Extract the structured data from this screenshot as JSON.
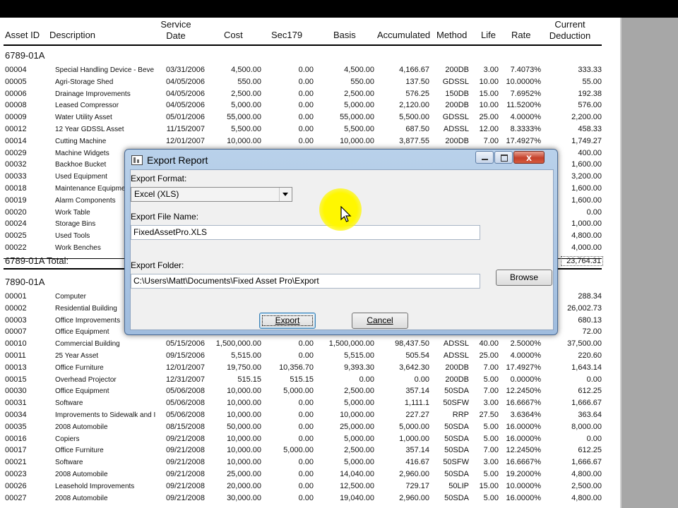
{
  "headers": {
    "asset_id": "Asset ID",
    "description": "Description",
    "service_date_1": "Service",
    "service_date_2": "Date",
    "cost": "Cost",
    "sec179": "Sec179",
    "basis": "Basis",
    "accumulated": "Accumulated",
    "method": "Method",
    "life": "Life",
    "rate": "Rate",
    "current_deduction_1": "Current",
    "current_deduction_2": "Deduction"
  },
  "groups": [
    {
      "title": "6789-01A",
      "rows": [
        {
          "id": "00004",
          "desc": "Special Handling Device - Beve",
          "date": "03/31/2006",
          "cost": "4,500.00",
          "sec": "0.00",
          "basis": "4,500.00",
          "acc": "4,166.67",
          "meth": "200DB",
          "life": "3.00",
          "rate": "7.4073%",
          "ded": "333.33"
        },
        {
          "id": "00005",
          "desc": "Agri-Storage Shed",
          "date": "04/05/2006",
          "cost": "550.00",
          "sec": "0.00",
          "basis": "550.00",
          "acc": "137.50",
          "meth": "GDSSL",
          "life": "10.00",
          "rate": "10.0000%",
          "ded": "55.00"
        },
        {
          "id": "00006",
          "desc": "Drainage Improvements",
          "date": "04/05/2006",
          "cost": "2,500.00",
          "sec": "0.00",
          "basis": "2,500.00",
          "acc": "576.25",
          "meth": "150DB",
          "life": "15.00",
          "rate": "7.6952%",
          "ded": "192.38"
        },
        {
          "id": "00008",
          "desc": "Leased Compressor",
          "date": "04/05/2006",
          "cost": "5,000.00",
          "sec": "0.00",
          "basis": "5,000.00",
          "acc": "2,120.00",
          "meth": "200DB",
          "life": "10.00",
          "rate": "11.5200%",
          "ded": "576.00"
        },
        {
          "id": "00009",
          "desc": "Water Utility Asset",
          "date": "05/01/2006",
          "cost": "55,000.00",
          "sec": "0.00",
          "basis": "55,000.00",
          "acc": "5,500.00",
          "meth": "GDSSL",
          "life": "25.00",
          "rate": "4.0000%",
          "ded": "2,200.00"
        },
        {
          "id": "00012",
          "desc": "12 Year GDSSL Asset",
          "date": "11/15/2007",
          "cost": "5,500.00",
          "sec": "0.00",
          "basis": "5,500.00",
          "acc": "687.50",
          "meth": "ADSSL",
          "life": "12.00",
          "rate": "8.3333%",
          "ded": "458.33"
        },
        {
          "id": "00014",
          "desc": "Cutting Machine",
          "date": "12/01/2007",
          "cost": "10,000.00",
          "sec": "0.00",
          "basis": "10,000.00",
          "acc": "3,877.55",
          "meth": "200DB",
          "life": "7.00",
          "rate": "17.4927%",
          "ded": "1,749.27"
        },
        {
          "id": "00029",
          "desc": "Machine Widgets",
          "date": "",
          "cost": "",
          "sec": "",
          "basis": "",
          "acc": "",
          "meth": "",
          "life": "",
          "rate": "",
          "ded": "400.00"
        },
        {
          "id": "00032",
          "desc": "Backhoe Bucket",
          "date": "",
          "cost": "",
          "sec": "",
          "basis": "",
          "acc": "",
          "meth": "",
          "life": "",
          "rate": "",
          "ded": "1,600.00"
        },
        {
          "id": "00033",
          "desc": "Used Equipment",
          "date": "",
          "cost": "",
          "sec": "",
          "basis": "",
          "acc": "",
          "meth": "",
          "life": "",
          "rate": "",
          "ded": "3,200.00"
        },
        {
          "id": "00018",
          "desc": "Maintenance Equipme",
          "date": "",
          "cost": "",
          "sec": "",
          "basis": "",
          "acc": "",
          "meth": "",
          "life": "",
          "rate": "",
          "ded": "1,600.00"
        },
        {
          "id": "00019",
          "desc": "Alarm Components",
          "date": "",
          "cost": "",
          "sec": "",
          "basis": "",
          "acc": "",
          "meth": "",
          "life": "",
          "rate": "",
          "ded": "1,600.00"
        },
        {
          "id": "00020",
          "desc": "Work Table",
          "date": "",
          "cost": "",
          "sec": "",
          "basis": "",
          "acc": "",
          "meth": "",
          "life": "",
          "rate": "",
          "ded": "0.00"
        },
        {
          "id": "00024",
          "desc": "Storage Bins",
          "date": "",
          "cost": "",
          "sec": "",
          "basis": "",
          "acc": "",
          "meth": "",
          "life": "",
          "rate": "",
          "ded": "1,000.00"
        },
        {
          "id": "00025",
          "desc": "Used Tools",
          "date": "",
          "cost": "",
          "sec": "",
          "basis": "",
          "acc": "",
          "meth": "",
          "life": "",
          "rate": "",
          "ded": "4,800.00"
        },
        {
          "id": "00022",
          "desc": "Work Benches",
          "date": "",
          "cost": "",
          "sec": "",
          "basis": "",
          "acc": "",
          "meth": "",
          "life": "",
          "rate": "",
          "ded": "4,000.00"
        }
      ],
      "total_label": "6789-01A Total:",
      "total_value": "23,764.31"
    },
    {
      "title": "7890-01A",
      "rows": [
        {
          "id": "00001",
          "desc": "Computer",
          "date": "",
          "cost": "",
          "sec": "",
          "basis": "",
          "acc": "",
          "meth": "",
          "life": "",
          "rate": "",
          "ded": "288.34"
        },
        {
          "id": "00002",
          "desc": "Residential Building",
          "date": "",
          "cost": "",
          "sec": "",
          "basis": "",
          "acc": "",
          "meth": "",
          "life": "",
          "rate": "",
          "ded": "26,002.73"
        },
        {
          "id": "00003",
          "desc": "Office Improvements",
          "date": "",
          "cost": "",
          "sec": "",
          "basis": "",
          "acc": "",
          "meth": "",
          "life": "",
          "rate": "",
          "ded": "680.13"
        },
        {
          "id": "00007",
          "desc": "Office Equipment",
          "date": "",
          "cost": "",
          "sec": "",
          "basis": "",
          "acc": "",
          "meth": "",
          "life": "",
          "rate": "",
          "ded": "72.00"
        },
        {
          "id": "00010",
          "desc": "Commercial Building",
          "date": "05/15/2006",
          "cost": "1,500,000.00",
          "sec": "0.00",
          "basis": "1,500,000.00",
          "acc": "98,437.50",
          "meth": "ADSSL",
          "life": "40.00",
          "rate": "2.5000%",
          "ded": "37,500.00"
        },
        {
          "id": "00011",
          "desc": "25 Year Asset",
          "date": "09/15/2006",
          "cost": "5,515.00",
          "sec": "0.00",
          "basis": "5,515.00",
          "acc": "505.54",
          "meth": "ADSSL",
          "life": "25.00",
          "rate": "4.0000%",
          "ded": "220.60"
        },
        {
          "id": "00013",
          "desc": "Office Furniture",
          "date": "12/01/2007",
          "cost": "19,750.00",
          "sec": "10,356.70",
          "basis": "9,393.30",
          "acc": "3,642.30",
          "meth": "200DB",
          "life": "7.00",
          "rate": "17.4927%",
          "ded": "1,643.14"
        },
        {
          "id": "00015",
          "desc": "Overhead Projector",
          "date": "12/31/2007",
          "cost": "515.15",
          "sec": "515.15",
          "basis": "0.00",
          "acc": "0.00",
          "meth": "200DB",
          "life": "5.00",
          "rate": "0.0000%",
          "ded": "0.00"
        },
        {
          "id": "00030",
          "desc": "Office Equipment",
          "date": "05/06/2008",
          "cost": "10,000.00",
          "sec": "5,000.00",
          "basis": "2,500.00",
          "acc": "357.14",
          "meth": "50SDA",
          "life": "7.00",
          "rate": "12.2450%",
          "ded": "612.25"
        },
        {
          "id": "00031",
          "desc": "Software",
          "date": "05/06/2008",
          "cost": "10,000.00",
          "sec": "0.00",
          "basis": "5,000.00",
          "acc": "1,111.1",
          "meth": "50SFW",
          "life": "3.00",
          "rate": "16.6667%",
          "ded": "1,666.67"
        },
        {
          "id": "00034",
          "desc": "Improvements to Sidewalk and I",
          "date": "05/06/2008",
          "cost": "10,000.00",
          "sec": "0.00",
          "basis": "10,000.00",
          "acc": "227.27",
          "meth": "RRP",
          "life": "27.50",
          "rate": "3.6364%",
          "ded": "363.64"
        },
        {
          "id": "00035",
          "desc": "2008 Automobile",
          "date": "08/15/2008",
          "cost": "50,000.00",
          "sec": "0.00",
          "basis": "25,000.00",
          "acc": "5,000.00",
          "meth": "50SDA",
          "life": "5.00",
          "rate": "16.0000%",
          "ded": "8,000.00"
        },
        {
          "id": "00016",
          "desc": "Copiers",
          "date": "09/21/2008",
          "cost": "10,000.00",
          "sec": "0.00",
          "basis": "5,000.00",
          "acc": "1,000.00",
          "meth": "50SDA",
          "life": "5.00",
          "rate": "16.0000%",
          "ded": "0.00"
        },
        {
          "id": "00017",
          "desc": "Office Furniture",
          "date": "09/21/2008",
          "cost": "10,000.00",
          "sec": "5,000.00",
          "basis": "2,500.00",
          "acc": "357.14",
          "meth": "50SDA",
          "life": "7.00",
          "rate": "12.2450%",
          "ded": "612.25"
        },
        {
          "id": "00021",
          "desc": "Software",
          "date": "09/21/2008",
          "cost": "10,000.00",
          "sec": "0.00",
          "basis": "5,000.00",
          "acc": "416.67",
          "meth": "50SFW",
          "life": "3.00",
          "rate": "16.6667%",
          "ded": "1,666.67"
        },
        {
          "id": "00023",
          "desc": "2008 Automobile",
          "date": "09/21/2008",
          "cost": "25,000.00",
          "sec": "0.00",
          "basis": "14,040.00",
          "acc": "2,960.00",
          "meth": "50SDA",
          "life": "5.00",
          "rate": "19.2000%",
          "ded": "4,800.00"
        },
        {
          "id": "00026",
          "desc": "Leasehold Improvements",
          "date": "09/21/2008",
          "cost": "20,000.00",
          "sec": "0.00",
          "basis": "12,500.00",
          "acc": "729.17",
          "meth": "50LIP",
          "life": "15.00",
          "rate": "10.0000%",
          "ded": "2,500.00"
        },
        {
          "id": "00027",
          "desc": "2008 Automobile",
          "date": "09/21/2008",
          "cost": "30,000.00",
          "sec": "0.00",
          "basis": "19,040.00",
          "acc": "2,960.00",
          "meth": "50SDA",
          "life": "5.00",
          "rate": "16.0000%",
          "ded": "4,800.00"
        }
      ]
    }
  ],
  "dialog": {
    "title": "Export Report",
    "close_glyph": "x",
    "format_label": "Export Format:",
    "format_value": "Excel (XLS)",
    "filename_label": "Export File Name:",
    "filename_value": "FixedAssetPro.XLS",
    "folder_label": "Export Folder:",
    "folder_value": "C:\\Users\\Matt\\Documents\\Fixed Asset Pro\\Export",
    "browse_label": "Browse",
    "export_label": "Export",
    "cancel_label": "Cancel"
  },
  "colors": {
    "cursor_highlight": "#fff700",
    "dialog_frame": "#b9d1ea",
    "close_button": "#c5412b"
  }
}
